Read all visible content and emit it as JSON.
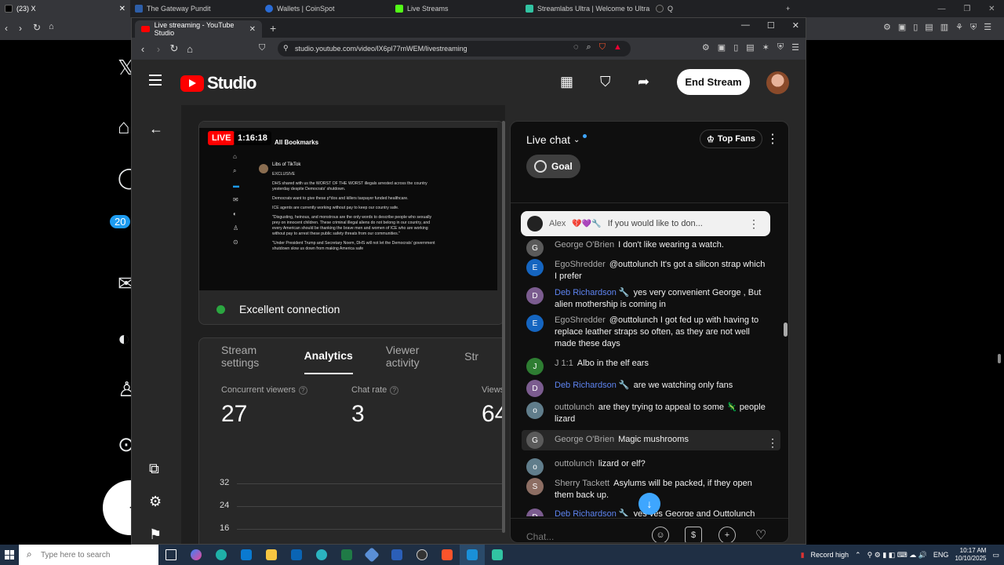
{
  "outer_tabs": [
    {
      "label": "(23) X",
      "color": "#000000"
    },
    {
      "label": "The Gateway Pundit",
      "color": "#2d5ea8"
    },
    {
      "label": "Wallets | CoinSpot",
      "color": "#2a6cd6"
    },
    {
      "label": "Live Streams",
      "color": "#53fc18"
    },
    {
      "label": "Streamlabs Ultra | Welcome to Ultra",
      "color": "#31c3a2"
    },
    {
      "label": "Q",
      "color": "#222222"
    }
  ],
  "bg_page": {
    "badge": "20"
  },
  "window": {
    "tab_title": "Live streaming - YouTube Studio",
    "url": "studio.youtube.com/video/lX6pl77mWEM/livestreaming"
  },
  "header": {
    "logo_text": "Studio",
    "end_stream_label": "End Stream"
  },
  "preview": {
    "live_label": "LIVE",
    "timer": "1:16:18",
    "inner_title": "All Bookmarks",
    "tweet_author": "Libs of TikTok",
    "tweet_lines": [
      "EXCLUSIVE",
      "DHS shared with us the WORST OF THE WORST illegals arrested across the country yesterday despite Democrats' shutdown.",
      "Democrats want to give these p*dos and killers taxpayer funded healthcare.",
      "ICE agents are currently working without pay to keep our country safe.",
      "\"Disgusting, heinous, and monstrous are the only words to describe people who sexually prey on innocent children. These criminal illegal aliens do not belong in our country, and every American should be thanking the brave men and women of ICE who are working without pay to arrest these public safety threats from our communities.\"",
      "\"Under President Trump and Secretary Noem, DHS will not let the Democrats' government shutdown slow us down from making America safe"
    ],
    "connection": "Excellent connection"
  },
  "stream_tabs": [
    "Stream settings",
    "Analytics",
    "Viewer activity",
    "Str"
  ],
  "metrics": [
    {
      "label": "Concurrent viewers",
      "value": "27"
    },
    {
      "label": "Chat rate",
      "value": "3"
    },
    {
      "label": "Views",
      "value": "64"
    }
  ],
  "chart_data": {
    "type": "line",
    "y_ticks": [
      "32",
      "24",
      "16"
    ],
    "series": []
  },
  "chat": {
    "title": "Live chat",
    "top_fans": "Top Fans",
    "goal": "Goal",
    "pinned_author": "Alex",
    "pinned_text": "If you would like to don...",
    "input_placeholder": "Chat...",
    "messages": [
      {
        "author": "George O'Brien",
        "text": "I don't like wearing a watch.",
        "avatar": "G",
        "color": "#5a5a5a",
        "mod": false
      },
      {
        "author": "EgoShredder",
        "text": "@outtolunch It's got a silicon strap which I prefer",
        "avatar": "E",
        "color": "#1565c0",
        "mod": false
      },
      {
        "author": "Deb Richardson 🔧",
        "text": "yes very convenient George , But alien mothership is coming in",
        "avatar": "D",
        "color": "#7b5c8f",
        "mod": true
      },
      {
        "author": "EgoShredder",
        "text": "@outtolunch I got fed up with having to replace leather straps so often, as they are not well made these days",
        "avatar": "E",
        "color": "#1565c0",
        "mod": false
      },
      {
        "author": "J 1:1",
        "text": "Albo in the elf ears",
        "avatar": "J",
        "color": "#2e7d32",
        "mod": false
      },
      {
        "author": "Deb Richardson 🔧",
        "text": "are we watching only fans",
        "avatar": "D",
        "color": "#7b5c8f",
        "mod": true
      },
      {
        "author": "outtolunch",
        "text": "are they trying to appeal to some 🦎 people lizard",
        "avatar": "o",
        "color": "#607d8b",
        "mod": false
      },
      {
        "author": "George O'Brien",
        "text": "Magic mushrooms",
        "avatar": "G",
        "color": "#5a5a5a",
        "mod": false
      },
      {
        "author": "outtolunch",
        "text": "lizard or elf?",
        "avatar": "o",
        "color": "#607d8b",
        "mod": false
      },
      {
        "author": "Sherry Tackett",
        "text": "Asylums will be packed, if they open them back up.",
        "avatar": "S",
        "color": "#8d6e63",
        "mod": false
      },
      {
        "author": "Deb Richardson 🔧",
        "text": "yes yes George and Outtolunch",
        "avatar": "D",
        "color": "#7b5c8f",
        "mod": true
      }
    ]
  },
  "taskbar": {
    "search_placeholder": "Type here to search",
    "record": "Record high",
    "lang": "ENG",
    "time": "10:17 AM",
    "date": "10/10/2025"
  }
}
